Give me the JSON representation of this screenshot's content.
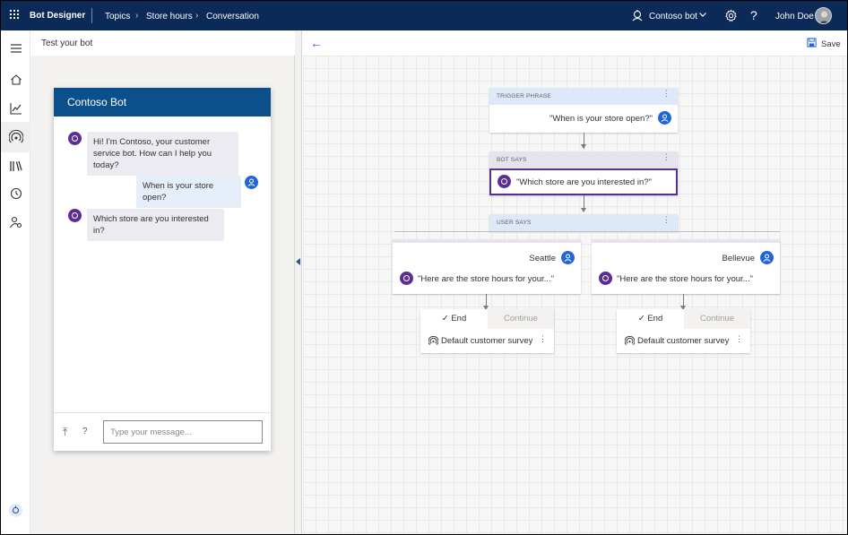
{
  "topbar": {
    "app_name": "Bot Designer",
    "breadcrumb": [
      "Topics",
      "Store hours",
      "Conversation"
    ],
    "bot_selector": "Contoso bot",
    "user_name": "John Doe"
  },
  "test_pane": {
    "title": "Test your bot",
    "chat_title": "Contoso Bot",
    "messages": [
      {
        "from": "bot",
        "text": "Hi! I'm Contoso, your customer service bot. How can I help you today?"
      },
      {
        "from": "user",
        "text": "When is your store open?"
      },
      {
        "from": "bot",
        "text": "Which store are you interested in?"
      }
    ],
    "input_placeholder": "Type your message..."
  },
  "canvas": {
    "save_label": "Save",
    "trigger": {
      "header": "TRIGGER PHRASE",
      "text": "\"When is your store open?\""
    },
    "bot_says": {
      "header": "BOT SAYS",
      "text": "\"Which store are you interested in?\""
    },
    "user_says": {
      "header": "USER SAYS"
    },
    "branches": [
      {
        "option": "Seattle",
        "response": "\"Here are the store hours for your...\"",
        "end_label": "End",
        "continue_label": "Continue",
        "survey": "Default customer survey"
      },
      {
        "option": "Bellevue",
        "response": "\"Here are the store hours for your...\"",
        "end_label": "End",
        "continue_label": "Continue",
        "survey": "Default customer survey"
      }
    ]
  },
  "colors": {
    "topbar": "#0b2a57",
    "chat_header": "#0b4f8b",
    "bot_avatar": "#5c2e91",
    "user_avatar": "#2266d4",
    "selected_border": "#5c2e91"
  }
}
